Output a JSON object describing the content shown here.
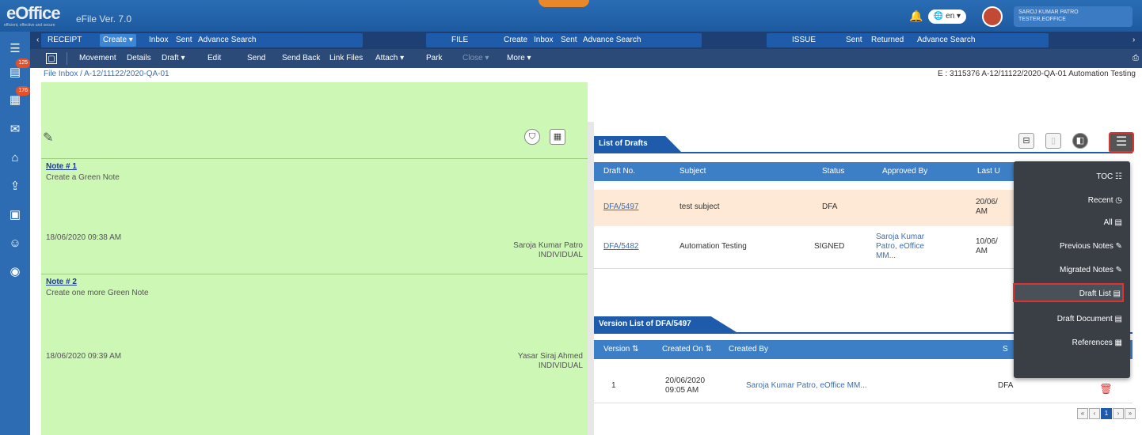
{
  "header": {
    "logo": "eOffice",
    "logo_sub": "efficient, effective and secure",
    "module": "eFile",
    "version": "Ver. 7.0",
    "lang": "en",
    "user_name": "SAROJ KUMAR PATRO",
    "user_role": "TESTER,EOFFICE"
  },
  "rail": {
    "badge1": "125",
    "badge2": "176"
  },
  "nav": {
    "receipt": {
      "label": "RECEIPT",
      "items": [
        "Create",
        "Inbox",
        "Sent",
        "Advance Search"
      ]
    },
    "file": {
      "label": "FILE",
      "items": [
        "Create",
        "Inbox",
        "Sent",
        "Advance Search"
      ]
    },
    "issue": {
      "label": "ISSUE",
      "items": [
        "Sent",
        "Returned",
        "Advance Search"
      ]
    }
  },
  "toolbar": {
    "items": [
      "Movement",
      "Details",
      "Draft ▾",
      "Edit",
      "Send",
      "Send Back",
      "Link Files",
      "Attach ▾",
      "Park",
      "Close ▾",
      "More ▾"
    ]
  },
  "breadcrumb": "File Inbox / A-12/11122/2020-QA-01",
  "file_info": "E : 3115376   A-12/11122/2020-QA-01   Automation Testing",
  "notes": [
    {
      "title": "Note # 1",
      "text": "Create a Green Note",
      "date": "18/06/2020 09:38 AM",
      "signer": "Saroja Kumar Patro",
      "type": "INDIVIDUAL"
    },
    {
      "title": "Note # 2",
      "text": "Create one more Green Note",
      "date": "18/06/2020 09:39 AM",
      "signer": "Yasar Siraj Ahmed",
      "type": "INDIVIDUAL"
    }
  ],
  "drafts": {
    "tab_title": "List of Drafts",
    "columns": [
      "Draft No.",
      "Subject",
      "Status",
      "Approved By",
      "Last U"
    ],
    "rows": [
      {
        "no": "DFA/5497",
        "subject": "test subject",
        "status": "DFA",
        "approved": "",
        "last": "20/06/ AM"
      },
      {
        "no": "DFA/5482",
        "subject": "Automation Testing",
        "status": "SIGNED",
        "approved": "Saroja Kumar Patro, eOffice MM...",
        "last": "10/06/ AM"
      }
    ]
  },
  "versions": {
    "tab_title": "Version List of DFA/5497",
    "columns": [
      "Version ⇅",
      "Created On ⇅",
      "Created By",
      "S"
    ],
    "rows": [
      {
        "version": "1",
        "created_on": "20/06/2020 09:05 AM",
        "created_by": "Saroja Kumar Patro, eOffice MM...",
        "status": "DFA"
      }
    ]
  },
  "menu": {
    "items": [
      "TOC",
      "Recent",
      "All",
      "Previous Notes",
      "Migrated Notes",
      "Draft List",
      "Draft Document",
      "References"
    ],
    "active": "Draft List"
  },
  "pager": [
    "«",
    "‹",
    "1",
    "›",
    "»"
  ]
}
